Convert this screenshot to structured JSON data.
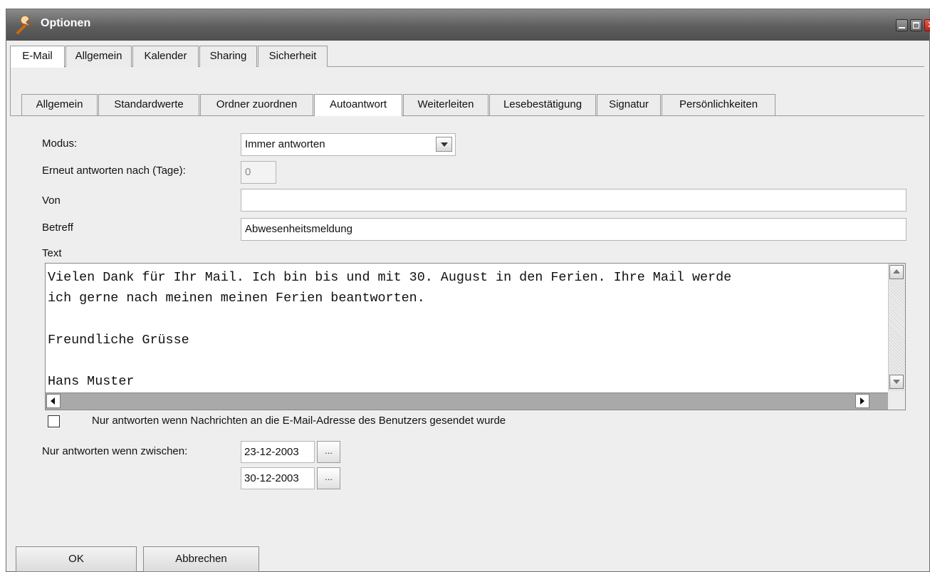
{
  "window": {
    "title": "Optionen"
  },
  "tabs_top": [
    {
      "label": "E-Mail",
      "active": true
    },
    {
      "label": "Allgemein",
      "active": false
    },
    {
      "label": "Kalender",
      "active": false
    },
    {
      "label": "Sharing",
      "active": false
    },
    {
      "label": "Sicherheit",
      "active": false
    }
  ],
  "tabs_sub": [
    {
      "label": "Allgemein",
      "active": false
    },
    {
      "label": "Standardwerte",
      "active": false
    },
    {
      "label": "Ordner zuordnen",
      "active": false
    },
    {
      "label": "Autoantwort",
      "active": true
    },
    {
      "label": "Weiterleiten",
      "active": false
    },
    {
      "label": "Lesebestätigung",
      "active": false
    },
    {
      "label": "Signatur",
      "active": false
    },
    {
      "label": "Persönlichkeiten",
      "active": false
    }
  ],
  "form": {
    "modus_label": "Modus:",
    "modus_value": "Immer antworten",
    "erneut_label": "Erneut antworten nach (Tage):",
    "erneut_value": "0",
    "von_label": "Von",
    "von_value": "",
    "betreff_label": "Betreff",
    "betreff_value": "Abwesenheitsmeldung",
    "text_label": "Text",
    "text_value": "Vielen Dank für Ihr Mail. Ich bin bis und mit 30. August in den Ferien. Ihre Mail werde\nich gerne nach meinen meinen Ferien beantworten.\n\nFreundliche Grüsse\n\nHans Muster",
    "checkbox_label": "Nur antworten wenn Nachrichten an die E-Mail-Adresse des Benutzers gesendet wurde",
    "checkbox_checked": false,
    "zwischen_label": "Nur antworten wenn zwischen:",
    "date_from": "23-12-2003",
    "date_to": "30-12-2003",
    "dots_label": "..."
  },
  "buttons": {
    "ok": "OK",
    "cancel": "Abbrechen"
  },
  "icons": {
    "title": "wrench-icon"
  },
  "colors": {
    "titlebar": "#5e5e5e",
    "close": "#d9382a",
    "window_bg": "#eeeeee"
  }
}
